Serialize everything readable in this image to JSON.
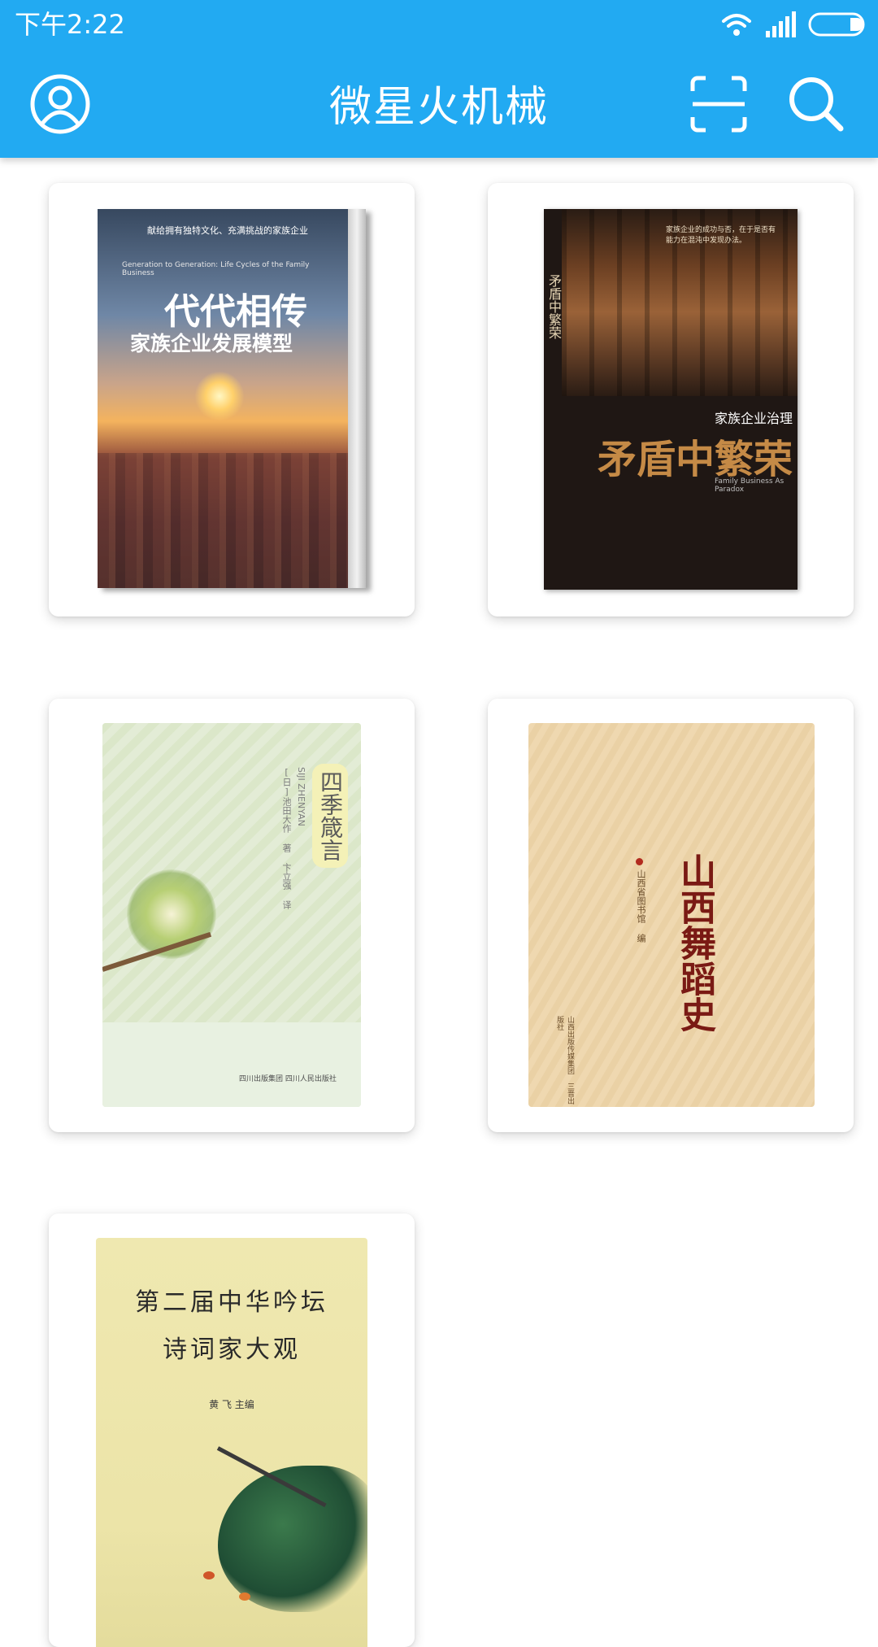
{
  "status_bar": {
    "time": "下午2:22"
  },
  "app_bar": {
    "title": "微星火机械",
    "icons": [
      "account-icon",
      "scan-icon",
      "search-icon"
    ]
  },
  "colors": {
    "primary": "#22aaf2",
    "background": "#ffffff"
  },
  "books": [
    {
      "cover_text": {
        "title": "代代相传",
        "subtitle": "家族企业发展模型",
        "tagline": "献给拥有独特文化、充满挑战的家族企业",
        "english": "Generation to Generation: Life Cycles of the Family Business"
      }
    },
    {
      "cover_text": {
        "series": "家族企业治理",
        "title": "矛盾中繁荣",
        "english": "Family Business As Paradox",
        "tagline": "家族企业的成功与否，在于是否有能力在混沌中发现办法。"
      }
    },
    {
      "cover_text": {
        "title": "四季箴言",
        "pinyin": "SIJI ZHENYAN",
        "author": "[日]池田大作 著 卞立强 译",
        "publisher": "四川出版集团 四川人民出版社"
      }
    },
    {
      "cover_text": {
        "title": "山西舞蹈史",
        "editor": "山西省图书馆 编",
        "publisher": "山西出版传媒集团 三晋出版社"
      }
    },
    {
      "cover_text": {
        "title_line1": "第二届中华吟坛",
        "title_line2": "诗词家大观",
        "editor": "黄 飞 主编"
      }
    }
  ]
}
